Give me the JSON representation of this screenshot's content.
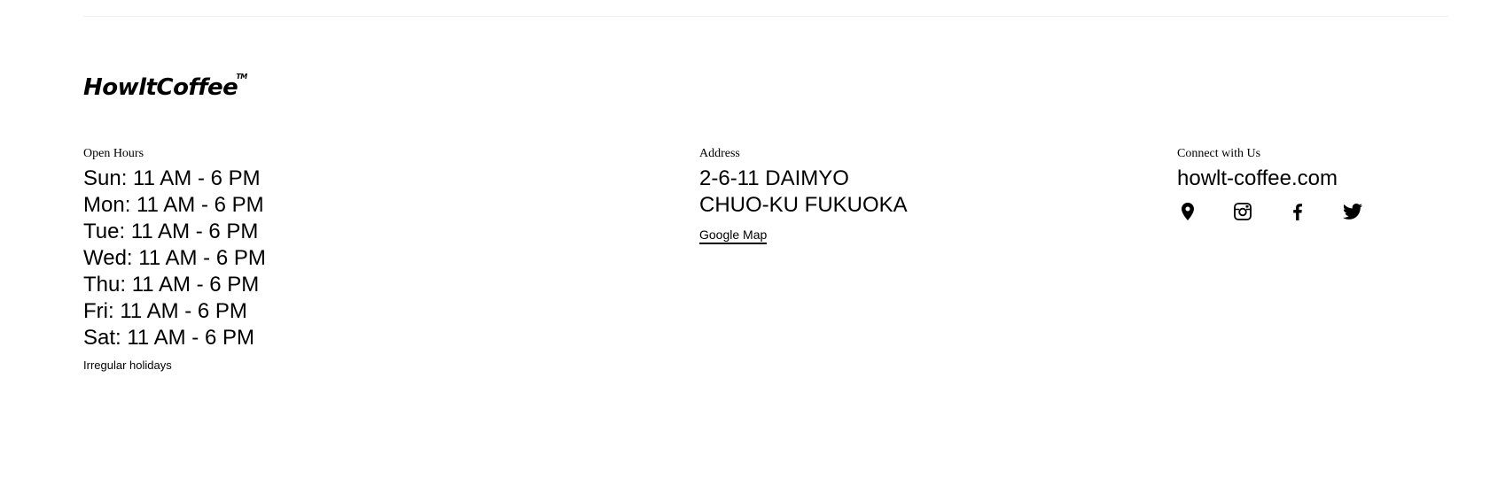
{
  "brand": {
    "logo_text": "HowltCoffee",
    "logo_tm": "TM"
  },
  "hours": {
    "label": "Open Hours",
    "days": [
      "Sun: 11 AM - 6 PM",
      "Mon: 11 AM - 6 PM",
      "Tue: 11 AM - 6 PM",
      "Wed: 11 AM - 6 PM",
      "Thu: 11 AM - 6 PM",
      "Fri: 11 AM - 6 PM",
      "Sat: 11 AM - 6 PM"
    ],
    "note": "Irregular holidays"
  },
  "address": {
    "label": "Address",
    "line1": "2-6-11 DAIMYO",
    "line2": "CHUO-KU FUKUOKA",
    "map_link": "Google Map"
  },
  "connect": {
    "label": "Connect with Us",
    "website": "howlt-coffee.com",
    "socials": [
      {
        "icon": "map-pin-icon"
      },
      {
        "icon": "instagram-icon"
      },
      {
        "icon": "facebook-icon"
      },
      {
        "icon": "twitter-icon"
      }
    ]
  },
  "colors": {
    "text": "#000000",
    "background": "#ffffff",
    "divider": "#eeeeee"
  }
}
